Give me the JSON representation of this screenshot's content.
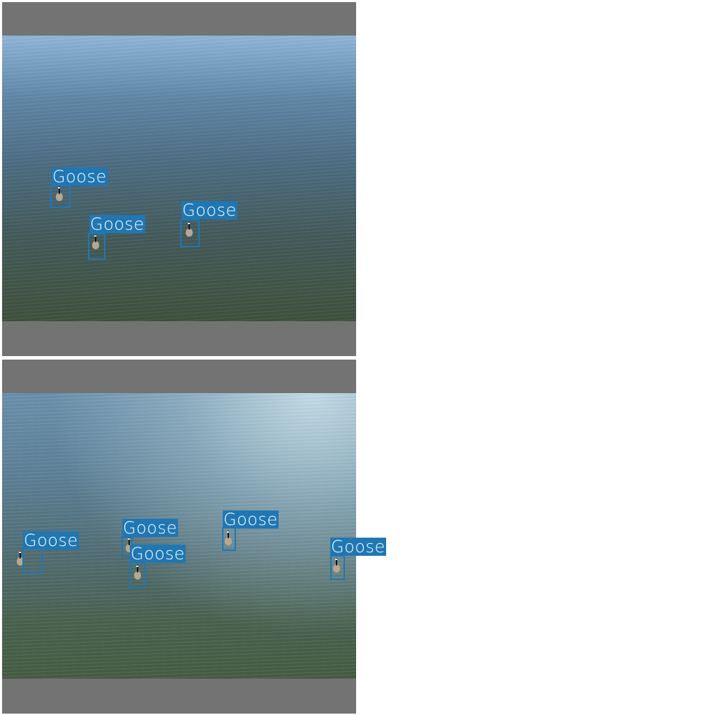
{
  "panels": [
    {
      "detections": [
        {
          "label": "Goose"
        },
        {
          "label": "Goose"
        },
        {
          "label": "Goose"
        }
      ]
    },
    {
      "detections": [
        {
          "label": "Goose"
        },
        {
          "label": "Goose"
        },
        {
          "label": "Goose"
        },
        {
          "label": "Goose"
        },
        {
          "label": "Goose"
        }
      ]
    }
  ],
  "colors": {
    "box": "#1f77b4",
    "label_text": "#ffffff",
    "padding": "#737373"
  }
}
